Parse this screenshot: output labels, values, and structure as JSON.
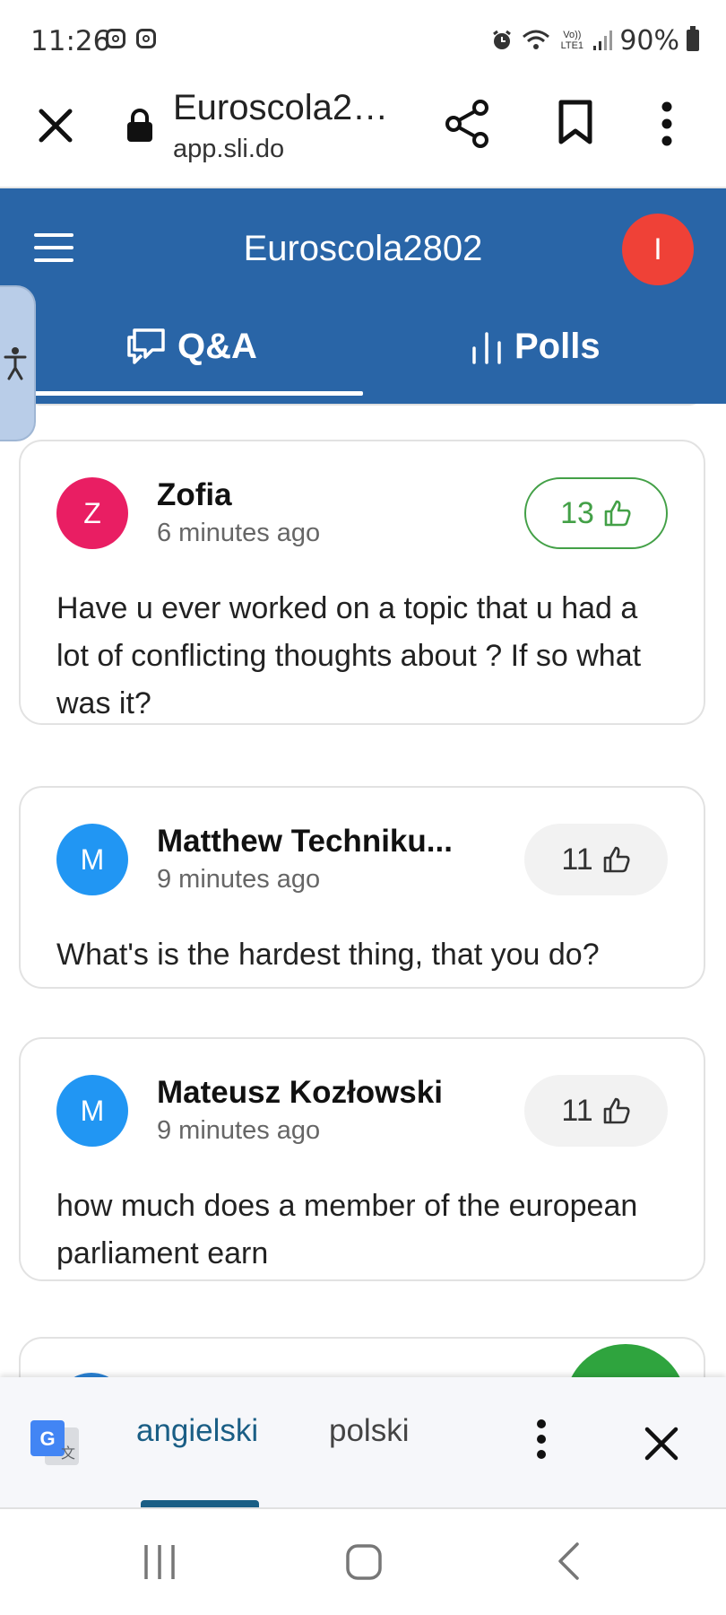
{
  "status_bar": {
    "time": "11:26",
    "network_label": "Vo)) LTE1",
    "battery": "90%"
  },
  "browser": {
    "title": "Euroscola2…",
    "url": "app.sli.do"
  },
  "app": {
    "event_title": "Euroscola2802",
    "user_initial": "I",
    "tabs": [
      {
        "label": "Q&A",
        "icon": "chat-bubbles-icon",
        "active": true
      },
      {
        "label": "Polls",
        "icon": "bar-chart-icon",
        "active": false
      }
    ]
  },
  "questions": [
    {
      "initial": "Z",
      "author": "Zofia",
      "time": "6 minutes ago",
      "likes": "13",
      "liked": true,
      "avatar_color": "#e91e63",
      "text": "Have u ever worked on a topic that u had a lot of conflicting thoughts about ? If so what was it?"
    },
    {
      "initial": "M",
      "author": "Matthew Techniku...",
      "time": "9 minutes ago",
      "likes": "11",
      "liked": false,
      "avatar_color": "#2196f3",
      "text": "What's is the hardest thing, that you do?"
    },
    {
      "initial": "M",
      "author": "Mateusz Kozłowski",
      "time": "9 minutes ago",
      "likes": "11",
      "liked": false,
      "avatar_color": "#2196f3",
      "text": "how much does a member of the european parliament earn"
    }
  ],
  "translate_bar": {
    "source_language": "angielski",
    "target_language": "polski"
  },
  "colors": {
    "header_blue": "#2965a7",
    "like_green": "#43a047",
    "user_red": "#ef4137",
    "fab_green": "#2fa43e"
  }
}
